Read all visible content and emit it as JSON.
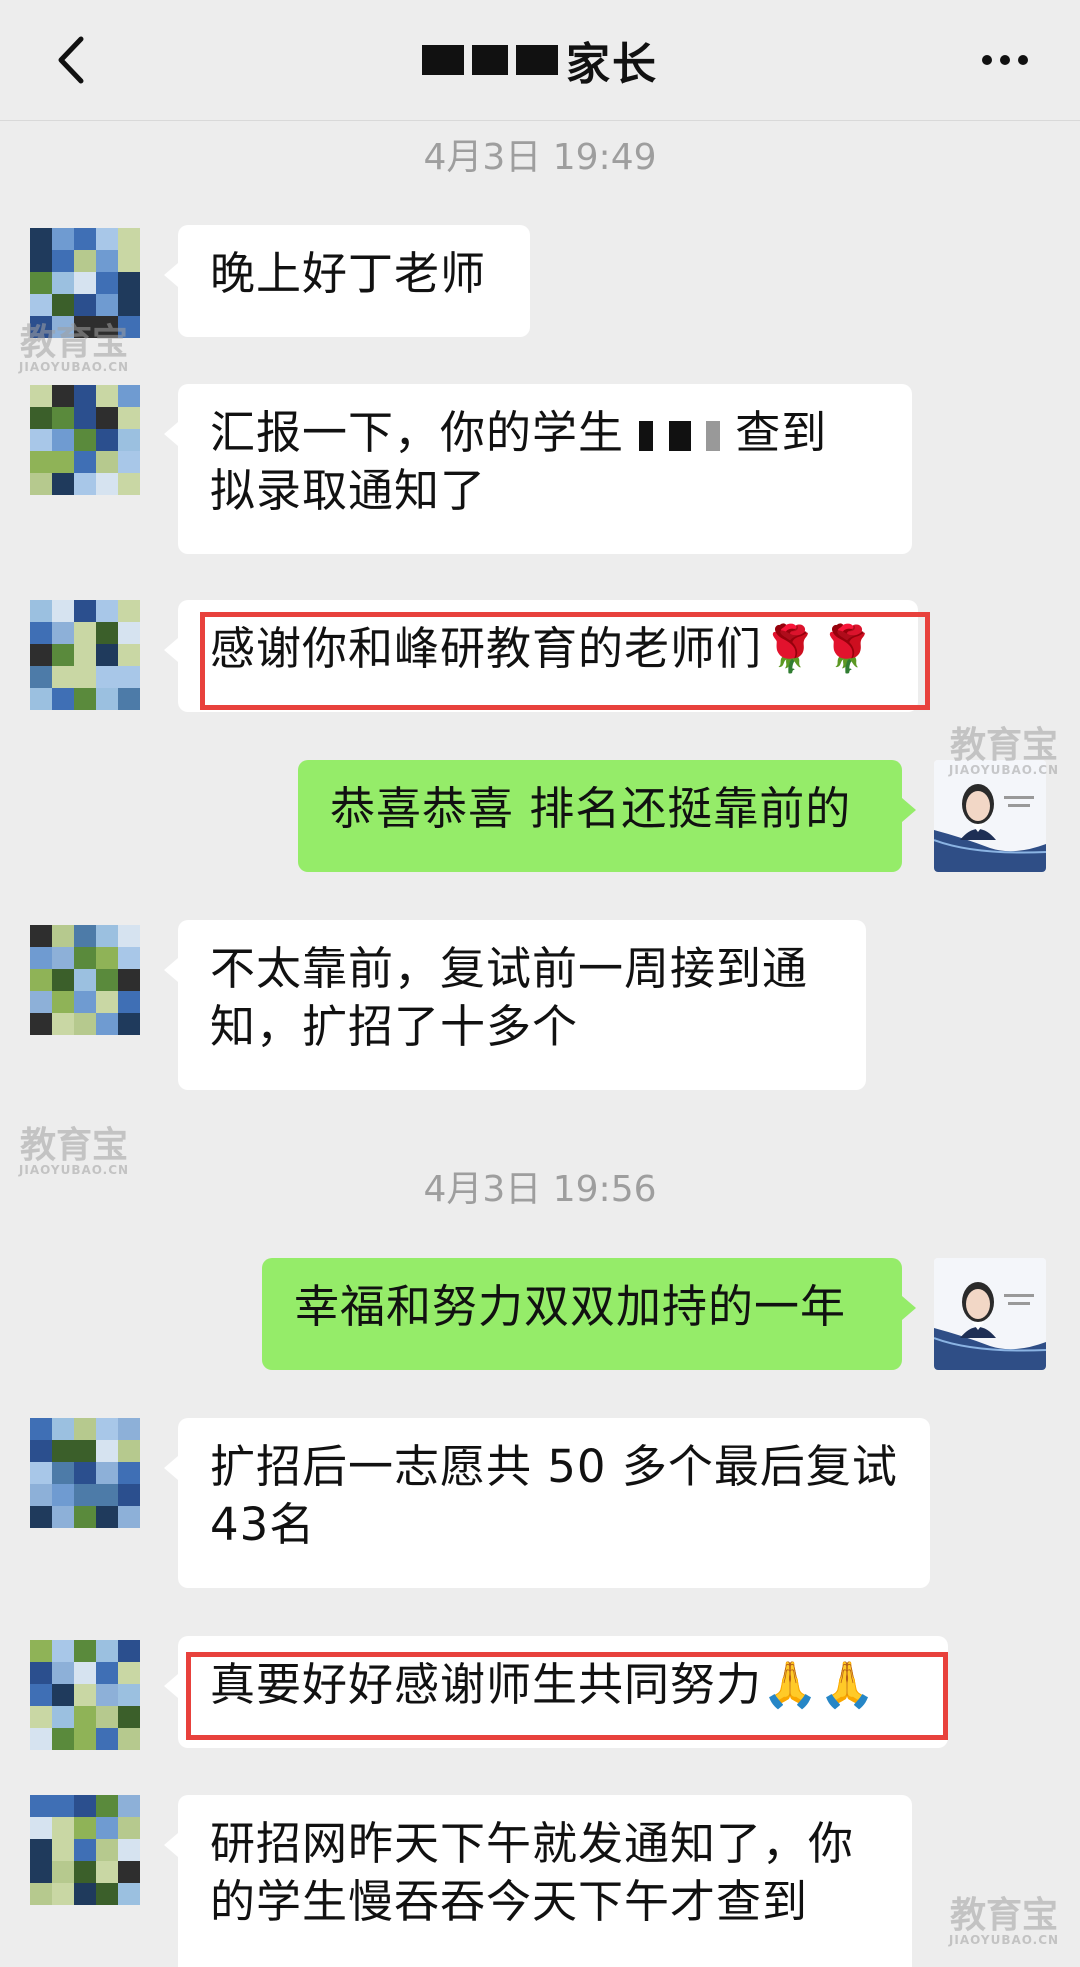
{
  "header": {
    "title": "家长",
    "back_icon": "chevron-left-icon",
    "more_icon": "more-dots-icon"
  },
  "timestamps": [
    "4月3日 19:49",
    "4月3日 19:56"
  ],
  "messages": [
    {
      "side": "left",
      "text": "晚上好丁老师"
    },
    {
      "side": "left",
      "text_a": "汇报一下，你的学生",
      "text_b": "查到",
      "text_c": "拟录取通知了"
    },
    {
      "side": "left",
      "text": "感谢你和峰研教育的老师们🌹🌹",
      "highlighted": true
    },
    {
      "side": "right",
      "text": "恭喜恭喜 排名还挺靠前的"
    },
    {
      "side": "left",
      "text": "不太靠前，复试前一周接到通知，扩招了十多个"
    },
    {
      "side": "right",
      "text": "幸福和努力双双加持的一年"
    },
    {
      "side": "left",
      "text": "扩招后一志愿共 50 多个最后复试43名"
    },
    {
      "side": "left",
      "text": "真要好好感谢师生共同努力🙏🙏",
      "highlighted": true
    },
    {
      "side": "left",
      "text": "研招网昨天下午就发通知了，你的学生慢吞吞今天下午才查到"
    }
  ],
  "watermark": {
    "cn": "教育宝",
    "en": "JIAOYUBAO.CN"
  },
  "colors": {
    "right_bubble": "#95ec69",
    "left_bubble": "#ffffff",
    "highlight": "#e8413c",
    "background": "#ededed"
  }
}
